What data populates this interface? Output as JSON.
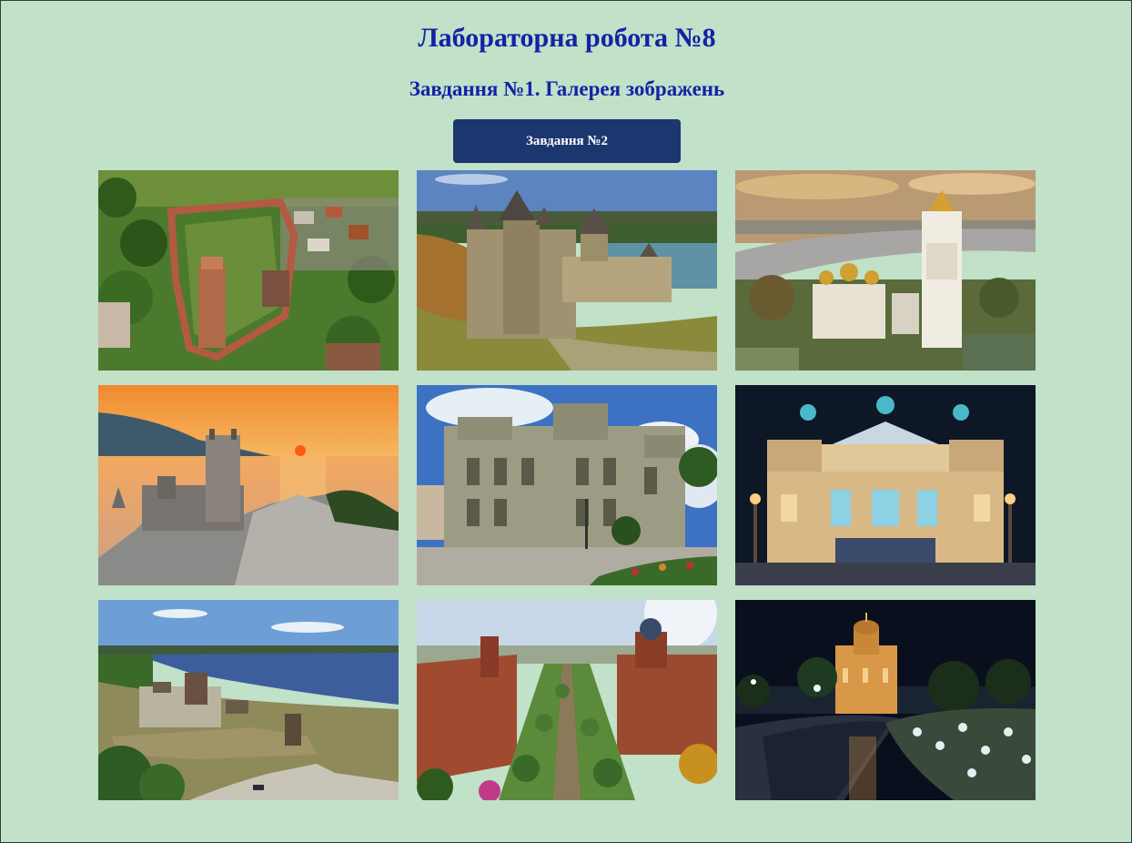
{
  "header": {
    "title": "Лабораторна робота №8",
    "subtitle": "Завдання №1. Галерея зображень",
    "button_label": "Завдання №2"
  },
  "gallery": {
    "images": [
      {
        "subject": "fortress-aerial"
      },
      {
        "subject": "khotyn-fortress"
      },
      {
        "subject": "kyiv-lavra"
      },
      {
        "subject": "swallows-nest"
      },
      {
        "subject": "house-with-chimaeras"
      },
      {
        "subject": "lviv-opera-night"
      },
      {
        "subject": "khortytsia-sich"
      },
      {
        "subject": "chernivtsi-university"
      },
      {
        "subject": "pyrohoshcha-church-night"
      }
    ]
  },
  "colors": {
    "background": "#c1e1c8",
    "heading": "#1323a6",
    "button": "#1c3670"
  }
}
